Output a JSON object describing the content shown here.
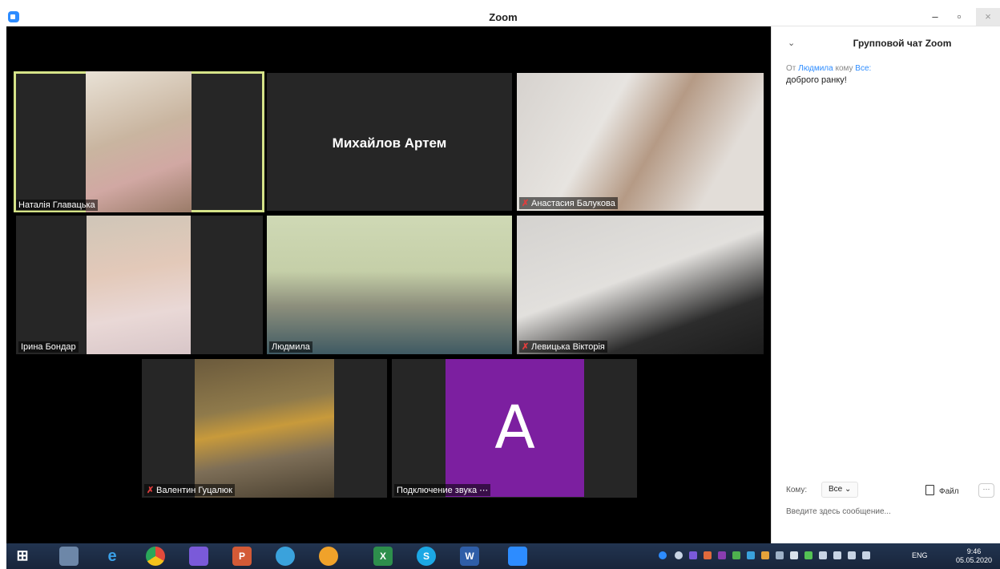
{
  "window": {
    "title": "Zoom",
    "min_label": "–",
    "max_label": "▫",
    "close_label": "×"
  },
  "participants": [
    {
      "name": "Наталія Главацька",
      "muted": false,
      "active": true
    },
    {
      "name": "Михайлов Артем",
      "muted": false,
      "video": false
    },
    {
      "name": "Анастасия Балукова",
      "muted": true
    },
    {
      "name": "Ірина Бондар",
      "muted": false
    },
    {
      "name": "Людмила",
      "muted": false
    },
    {
      "name": "Левицька Вікторія",
      "muted": true
    },
    {
      "name": "Валентин Гуцалюк",
      "muted": true
    },
    {
      "name": "Подключение звука ⋯",
      "muted": false,
      "avatar_letter": "A"
    }
  ],
  "chat": {
    "title": "Групповой чат Zoom",
    "collapse_icon": "chevron-down-icon",
    "message": {
      "from_prefix": "От",
      "from": "Людмила",
      "to_prefix": "кому",
      "to": "Все:",
      "text": "доброго ранку!"
    },
    "to_label": "Кому:",
    "to_value": "Все",
    "file_label": "Файл",
    "more_label": "···",
    "input_placeholder": "Введите здесь сообщение..."
  },
  "taskbar": {
    "language": "ENG",
    "time": "9:46",
    "date": "05.05.2020"
  },
  "colors": {
    "accent": "#2D8CFF",
    "active_speaker": "#d5e388",
    "avatar_purple": "#7c1fa0"
  }
}
